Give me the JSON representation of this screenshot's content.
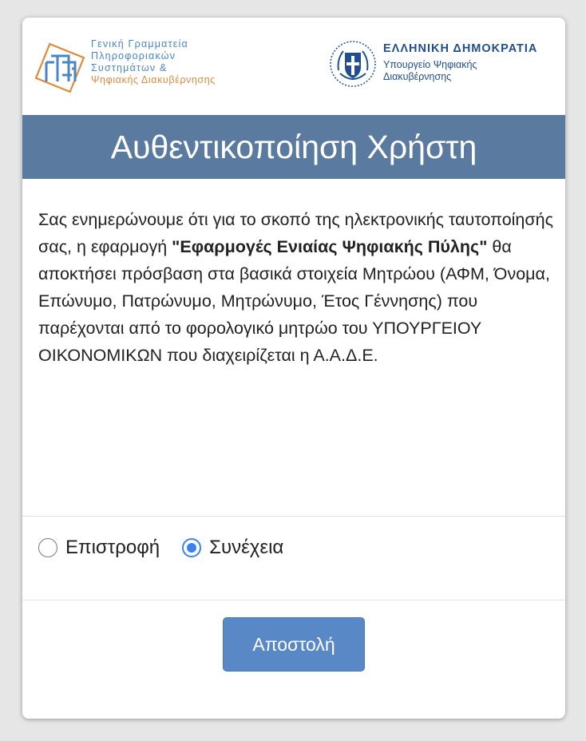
{
  "header": {
    "gsis_logo_lines": [
      "Γενική Γραμματεία",
      "Πληροφοριακών",
      "Συστημάτων &",
      "Ψηφιακής Διακυβέρνησης"
    ],
    "gov_title": "ΕΛΛΗΝΙΚΗ ΔΗΜΟΚΡΑΤΙΑ",
    "gov_sub_lines": [
      "Υπουργείο Ψηφιακής",
      "Διακυβέρνησης"
    ]
  },
  "title": "Αυθεντικοποίηση Χρήστη",
  "message": {
    "part1": "Σας ενημερώνουμε ότι για το σκοπό της ηλεκτρονικής ταυτοποίησής σας, η εφαρμογή ",
    "app_name": "\"Εφαρμογές Ενιαίας Ψηφιακής Πύλης\"",
    "part2": " θα αποκτήσει πρόσβαση στα βασικά στοιχεία Μητρώου (ΑΦΜ, Όνομα, Επώνυμο, Πατρώνυμο, Μητρώνυμο, Έτος Γέννησης) που παρέχονται από το φορολογικό μητρώο του ΥΠΟΥΡΓΕΙΟΥ ΟΙΚΟΝΟΜΙΚΩΝ που διαχειρίζεται η Α.Α.Δ.Ε."
  },
  "options": {
    "back_label": "Επιστροφή",
    "continue_label": "Συνέχεια",
    "selected": "continue"
  },
  "submit_label": "Αποστολή",
  "colors": {
    "title_bar": "#5b7aa0",
    "button": "#5889c6",
    "radio_accent": "#3b82f0",
    "gsis_blue": "#4a86c5",
    "gsis_orange": "#e08a3c",
    "gov_blue": "#1f4f8f"
  },
  "icons": {
    "gsis_logo": "gsis-logo-icon",
    "gov_emblem": "greek-coat-of-arms-icon"
  }
}
